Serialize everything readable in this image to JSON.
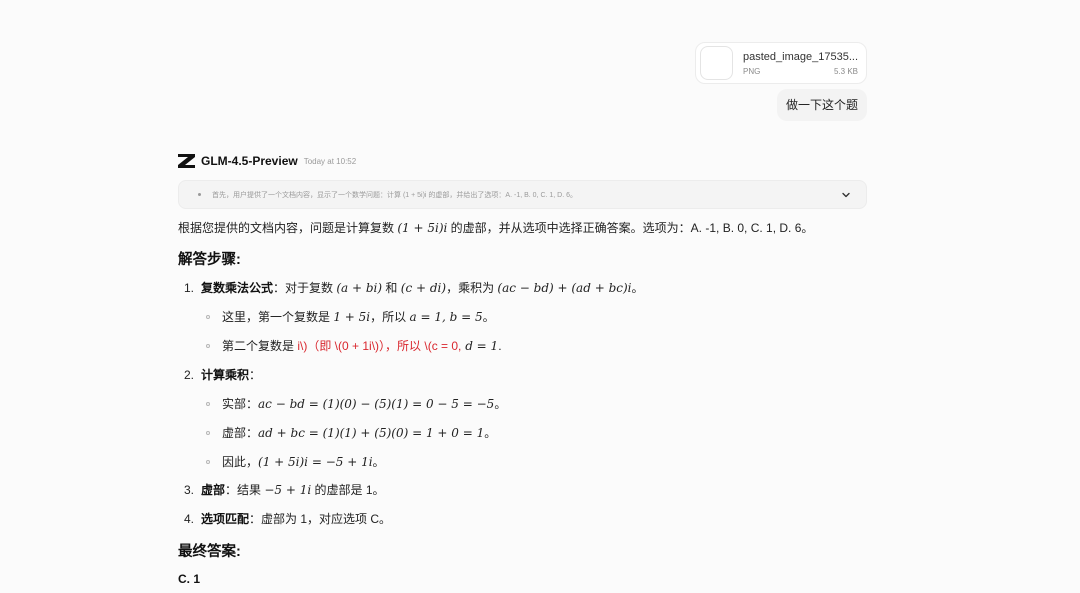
{
  "attachment": {
    "file_name": "pasted_image_17535...",
    "file_type": "PNG",
    "file_size": "5.3 KB"
  },
  "user_message": "做一下这个题",
  "assistant": {
    "model_name": "GLM-4.5-Preview",
    "timestamp": "Today at 10:52",
    "thinking_summary": "首先，用户提供了一个文档内容，显示了一个数学问题：计算 (1 + 5i)i 的虚部，并给出了选项：A. -1, B. 0, C. 1, D. 6。",
    "intro_prefix": "根据您提供的文档内容，问题是计算复数 ",
    "intro_math": "(1 + 5i)i",
    "intro_suffix": " 的虚部，并从选项中选择正确答案。选项为：A. -1, B. 0, C. 1, D. 6。",
    "steps_heading": "解答步骤:",
    "step1": {
      "number": "1.",
      "title": "复数乘法公式",
      "text1": "：对于复数 ",
      "math1": "(a + bi)",
      "text2": " 和 ",
      "math2": "(c + di)",
      "text3": "，乘积为 ",
      "math3": "(ac − bd) + (ad + bc)i",
      "text4": "。",
      "sub1_text": "这里，第一个复数是 ",
      "sub1_math1": "1 + 5i",
      "sub1_text2": "，所以 ",
      "sub1_math2": "a = 1, b = 5",
      "sub1_text3": "。",
      "sub2_text": "第二个复数是 ",
      "sub2_red": "i\\)（即 \\(0 + 1i\\)），所以 \\(c = 0,",
      "sub2_math": " d = 1",
      "sub2_end": "."
    },
    "step2": {
      "number": "2.",
      "title": "计算乘积",
      "colon": "：",
      "real_label": "实部：",
      "real_math": "ac − bd = (1)(0) − (5)(1) = 0 − 5 = −5",
      "real_end": "。",
      "imag_label": "虚部：",
      "imag_math": "ad + bc = (1)(1) + (5)(0) = 1 + 0 = 1",
      "imag_end": "。",
      "thus_label": "因此，",
      "thus_math": "(1 + 5i)i = −5 + 1i",
      "thus_end": "。"
    },
    "step3": {
      "number": "3.",
      "title": "虚部",
      "text1": "：结果 ",
      "math": "−5 + 1i",
      "text2": " 的虚部是 1。"
    },
    "step4": {
      "number": "4.",
      "title": "选项匹配",
      "text": "：虚部为 1，对应选项 C。"
    },
    "final_heading": "最终答案:",
    "final_answer": "C. 1"
  }
}
